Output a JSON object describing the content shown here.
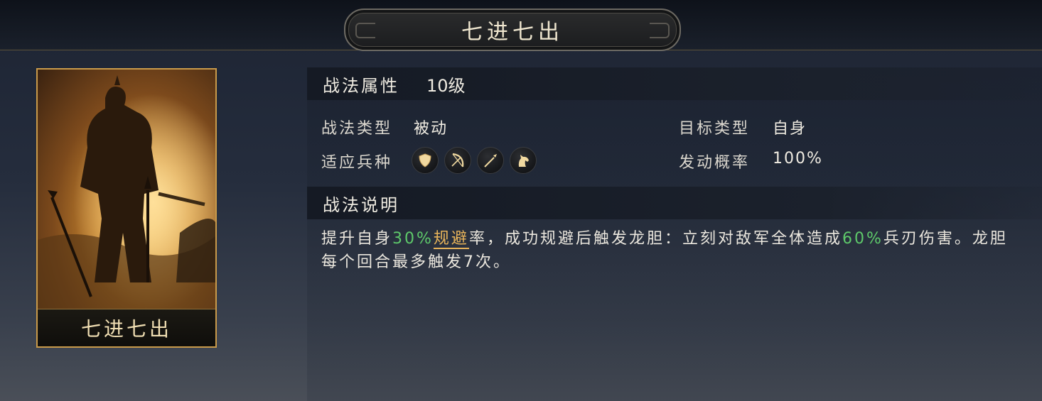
{
  "header": {
    "title": "七进七出"
  },
  "card": {
    "name": "七进七出"
  },
  "attributes": {
    "section_title": "战法属性",
    "level": "10级"
  },
  "rows": {
    "type_label": "战法类型",
    "type_value": "被动",
    "target_label": "目标类型",
    "target_value": "自身",
    "troops_label": "适应兵种",
    "rate_label": "发动概率",
    "rate_value": "100%"
  },
  "troop_icons": [
    "shield-icon",
    "bow-icon",
    "spear-icon",
    "horse-icon"
  ],
  "description": {
    "section_title": "战法说明",
    "p1": "提升自身",
    "p2": "30%",
    "p3": "规避",
    "p4": "率，成功规避后触发龙胆：立刻对敌军全体造成",
    "p5": "60%",
    "p6": "兵刃伤害",
    "p7": "。龙胆每个回合最多触发7次。"
  },
  "colors": {
    "highlight_green": "#5ec96a",
    "highlight_gold": "#e8b45a",
    "card_border": "#c99a4a"
  }
}
